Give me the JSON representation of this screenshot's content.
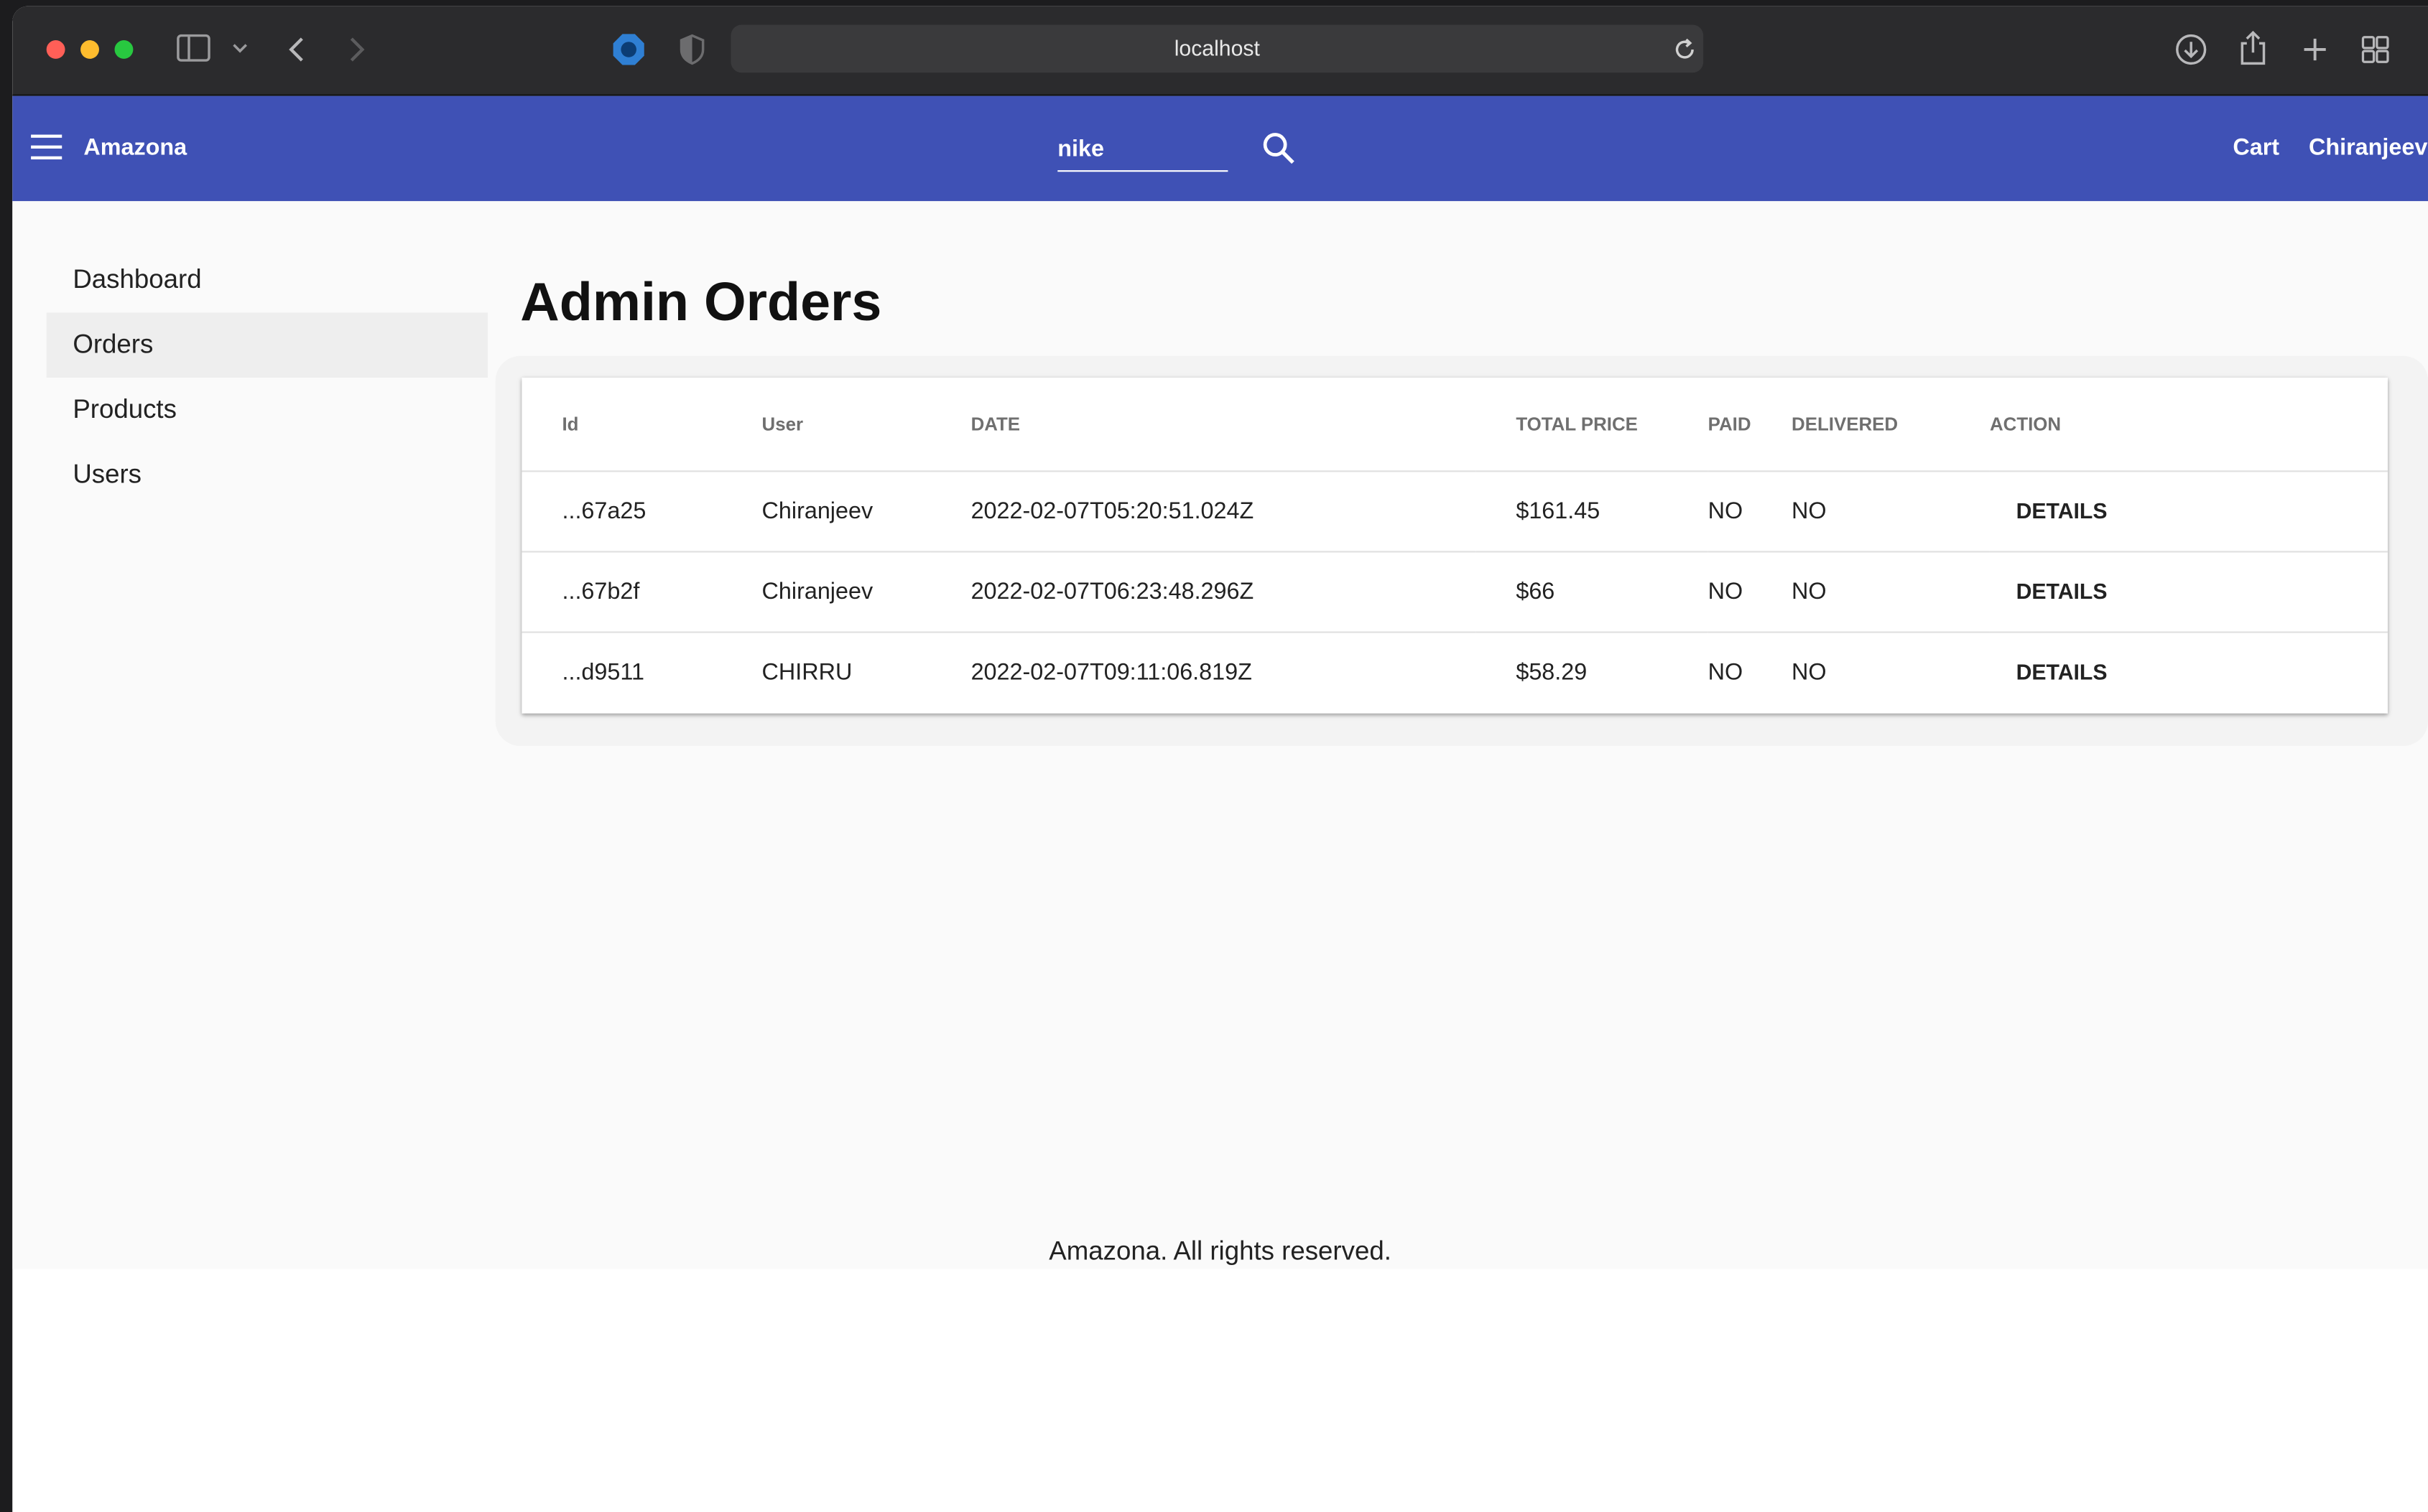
{
  "browser": {
    "address": "localhost"
  },
  "header": {
    "brand": "Amazona",
    "search_value": "nike",
    "cart_label": "Cart",
    "user_label": "Chiranjeev",
    "bar_color": "#3f51b5"
  },
  "sidebar": {
    "items": [
      {
        "label": "Dashboard",
        "active": false
      },
      {
        "label": "Orders",
        "active": true
      },
      {
        "label": "Products",
        "active": false
      },
      {
        "label": "Users",
        "active": false
      }
    ]
  },
  "main": {
    "title": "Admin Orders",
    "table": {
      "columns": [
        "Id",
        "User",
        "DATE",
        "TOTAL PRICE",
        "PAID",
        "DELIVERED",
        "ACTION"
      ],
      "rows": [
        {
          "id": "...67a25",
          "user": "Chiranjeev",
          "date": "2022-02-07T05:20:51.024Z",
          "total": "$161.45",
          "paid": "NO",
          "delivered": "NO",
          "action": "DETAILS"
        },
        {
          "id": "...67b2f",
          "user": "Chiranjeev",
          "date": "2022-02-07T06:23:48.296Z",
          "total": "$66",
          "paid": "NO",
          "delivered": "NO",
          "action": "DETAILS"
        },
        {
          "id": "...d9511",
          "user": "CHIRRU",
          "date": "2022-02-07T09:11:06.819Z",
          "total": "$58.29",
          "paid": "NO",
          "delivered": "NO",
          "action": "DETAILS"
        }
      ]
    }
  },
  "footer": {
    "text": "Amazona. All rights reserved."
  },
  "icons": [
    "sidebar-toggle-icon",
    "chevron-down-icon",
    "back-icon",
    "forward-icon",
    "extension-icon",
    "privacy-shield-icon",
    "reload-icon",
    "download-icon",
    "share-icon",
    "new-tab-icon",
    "tab-overview-icon",
    "hamburger-menu-icon",
    "search-icon"
  ]
}
